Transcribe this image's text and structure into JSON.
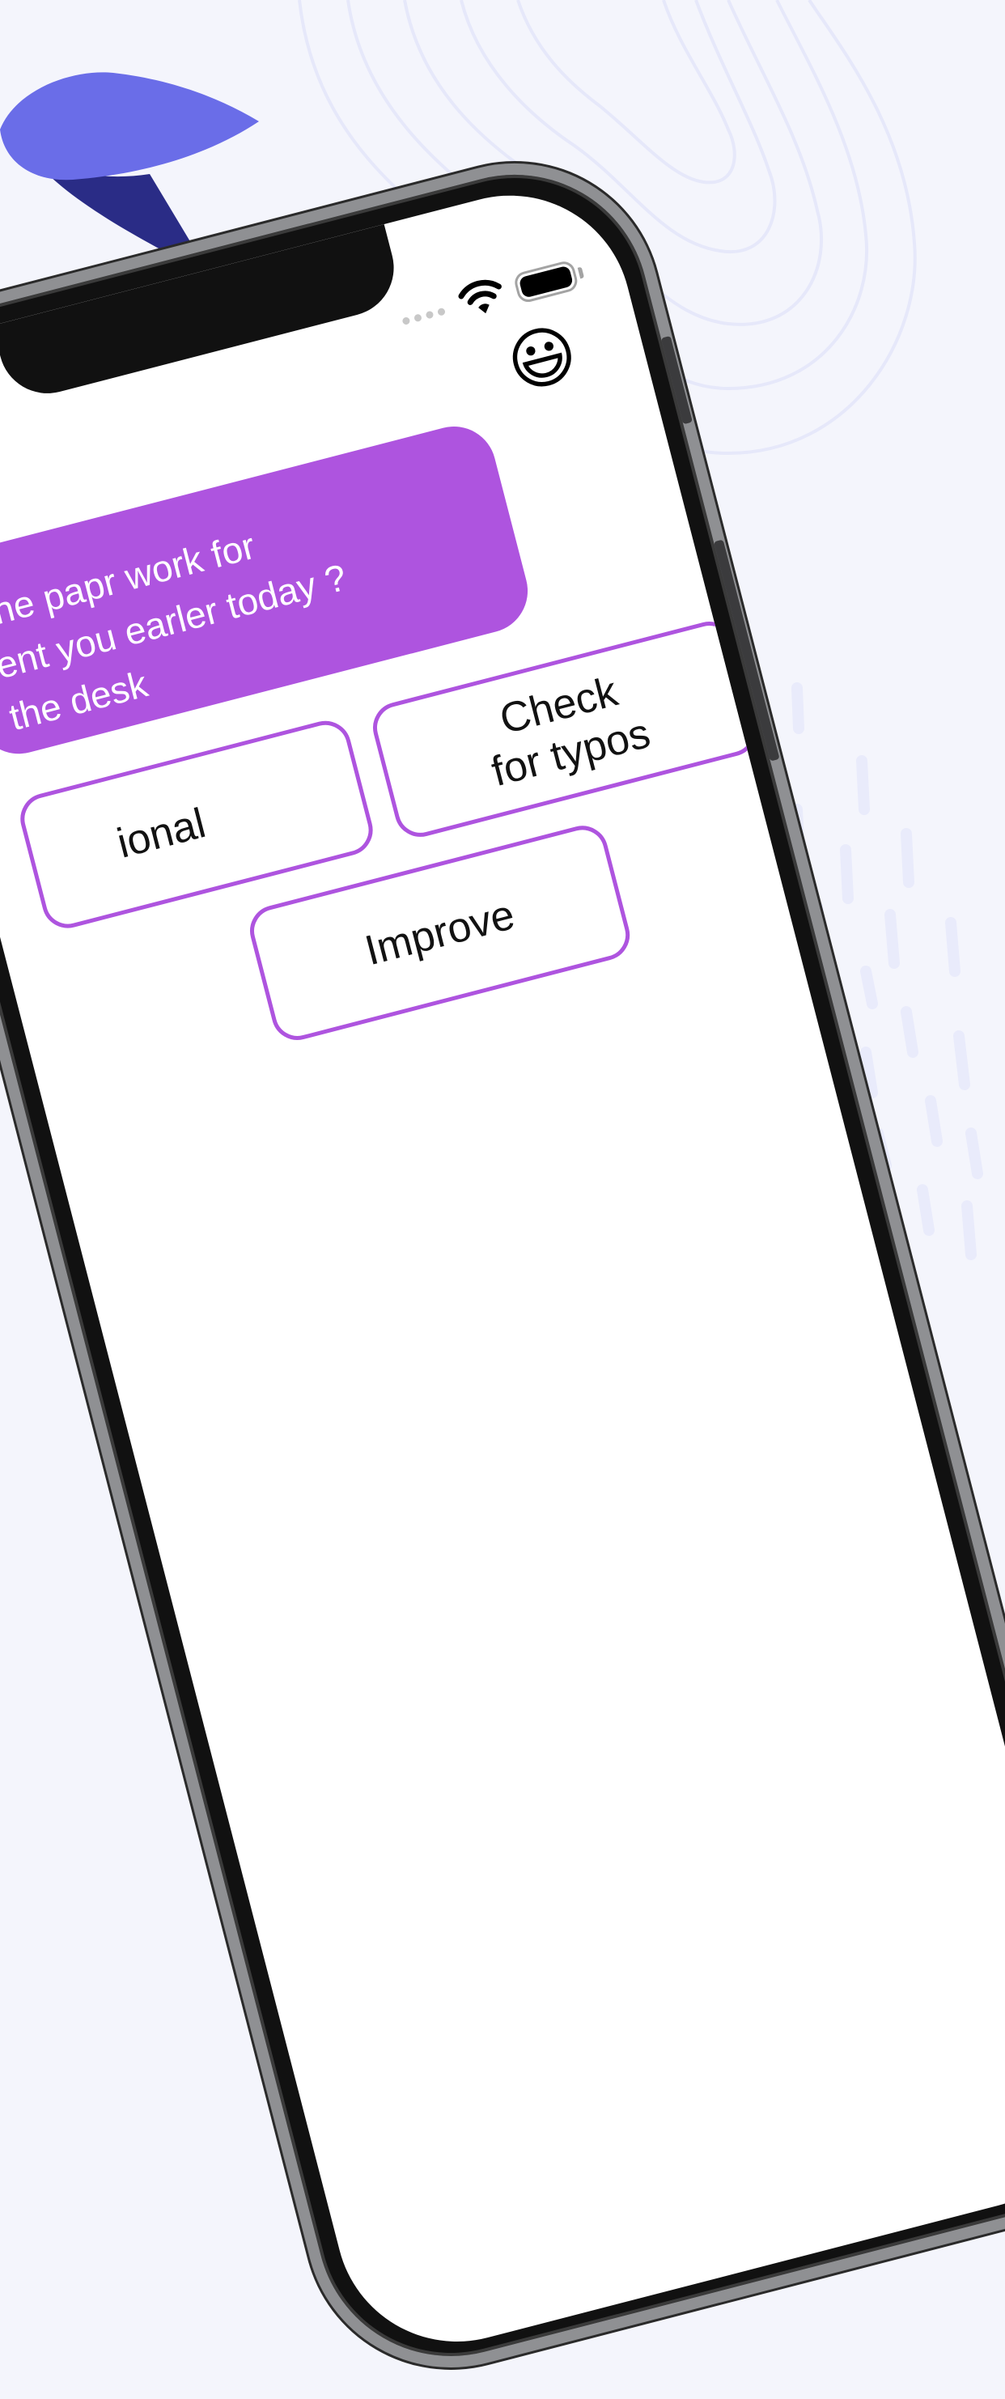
{
  "chat": {
    "avatar_emoji": "😃",
    "message_line_1": "the papr work for",
    "message_line_2": "ent you earler today ?",
    "message_line_3": "the desk"
  },
  "actions": {
    "professional_label": "ional",
    "check_typos_label": "Check\nfor typos",
    "improve_label": "Improve"
  },
  "colors": {
    "accent": "#ae54df",
    "logo_light": "#6a6de8",
    "logo_dark": "#2a2c86",
    "background": "#f4f5fc"
  }
}
